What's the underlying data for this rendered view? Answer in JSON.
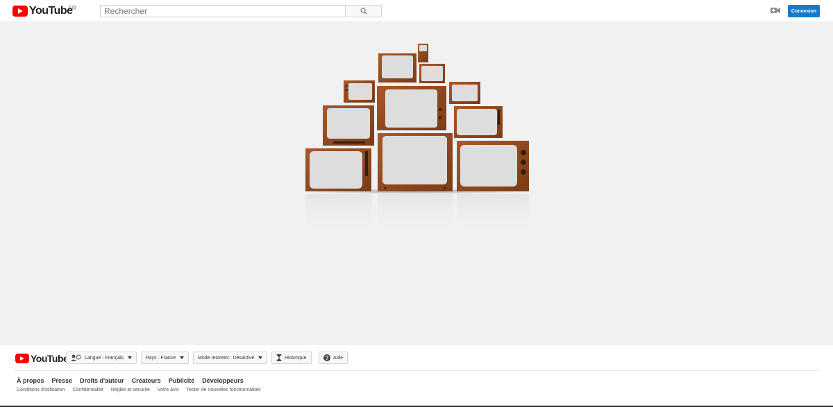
{
  "header": {
    "logo_text": "YouTube",
    "country_code": "FR",
    "search_placeholder": "Rechercher",
    "upload_icon": "video-camera-plus-icon",
    "signin_label": "Connexion",
    "brand_color": "#ff0000",
    "signin_color": "#167ac6"
  },
  "illustration": {
    "description_icon": "stacked-tvs-illustration"
  },
  "footer": {
    "logo_text": "YouTube",
    "language_label": "Langue : Français",
    "country_label": "Pays : France",
    "restricted_label": "Mode restreint : Désactivé",
    "history_label": "Historique",
    "help_label": "Aide",
    "primary_links": [
      "À propos",
      "Presse",
      "Droits d'auteur",
      "Créateurs",
      "Publicité",
      "Développeurs"
    ],
    "secondary_links": [
      "Conditions d'utilisation",
      "Confidentialité",
      "Règles et sécurité",
      "Votre avis",
      "Tester de nouvelles fonctionnalités"
    ]
  }
}
